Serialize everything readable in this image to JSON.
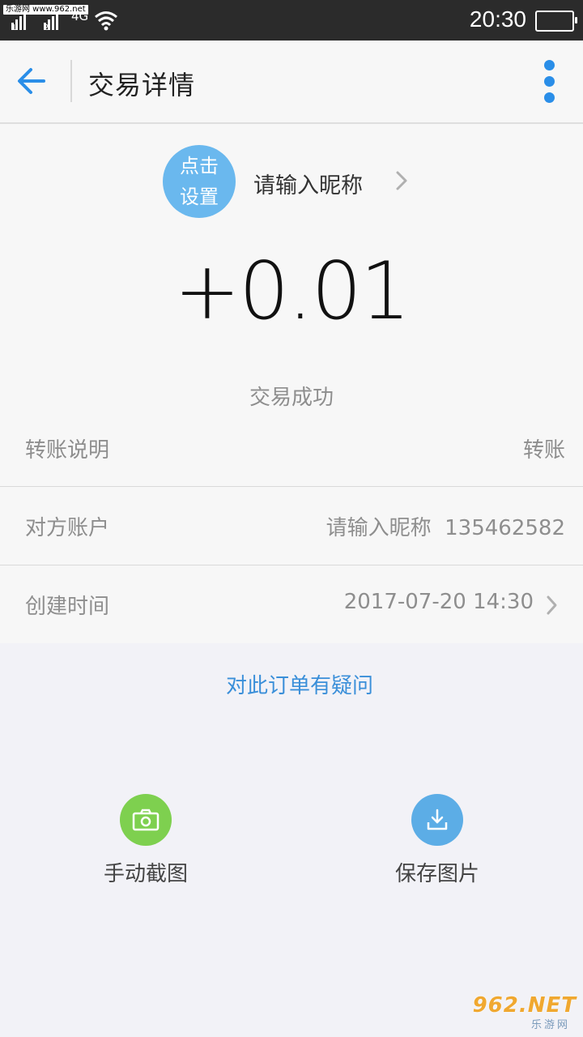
{
  "status_bar": {
    "watermark": "乐游网 www.962.net",
    "sim1": "1",
    "sim2": "2",
    "network": "4G",
    "time": "20:30",
    "icons": [
      "signal-icon",
      "wifi-icon",
      "battery-icon"
    ]
  },
  "header": {
    "title": "交易详情",
    "back_icon": "arrow-left-icon",
    "more_icon": "more-vertical-icon"
  },
  "profile": {
    "avatar_line1": "点击",
    "avatar_line2": "设置",
    "nickname": "请输入昵称"
  },
  "transaction": {
    "amount": "+0.01",
    "status": "交易成功",
    "rows": [
      {
        "label": "转账说明",
        "value": "转账"
      },
      {
        "label": "对方账户",
        "value": "请输入昵称  135462582"
      },
      {
        "label": "创建时间",
        "value": "2017-07-20 14:30"
      }
    ]
  },
  "question_link": "对此订单有疑问",
  "actions": {
    "screenshot": {
      "label": "手动截图",
      "icon": "camera-icon",
      "color": "#7ed04f"
    },
    "save": {
      "label": "保存图片",
      "icon": "download-icon",
      "color": "#5cade6"
    }
  },
  "watermark_br": {
    "brand": "962.NET",
    "sub": "乐游网"
  },
  "colors": {
    "accent": "#2a8ee8",
    "link": "#3a8fd9",
    "avatar": "#6ab8ee"
  }
}
